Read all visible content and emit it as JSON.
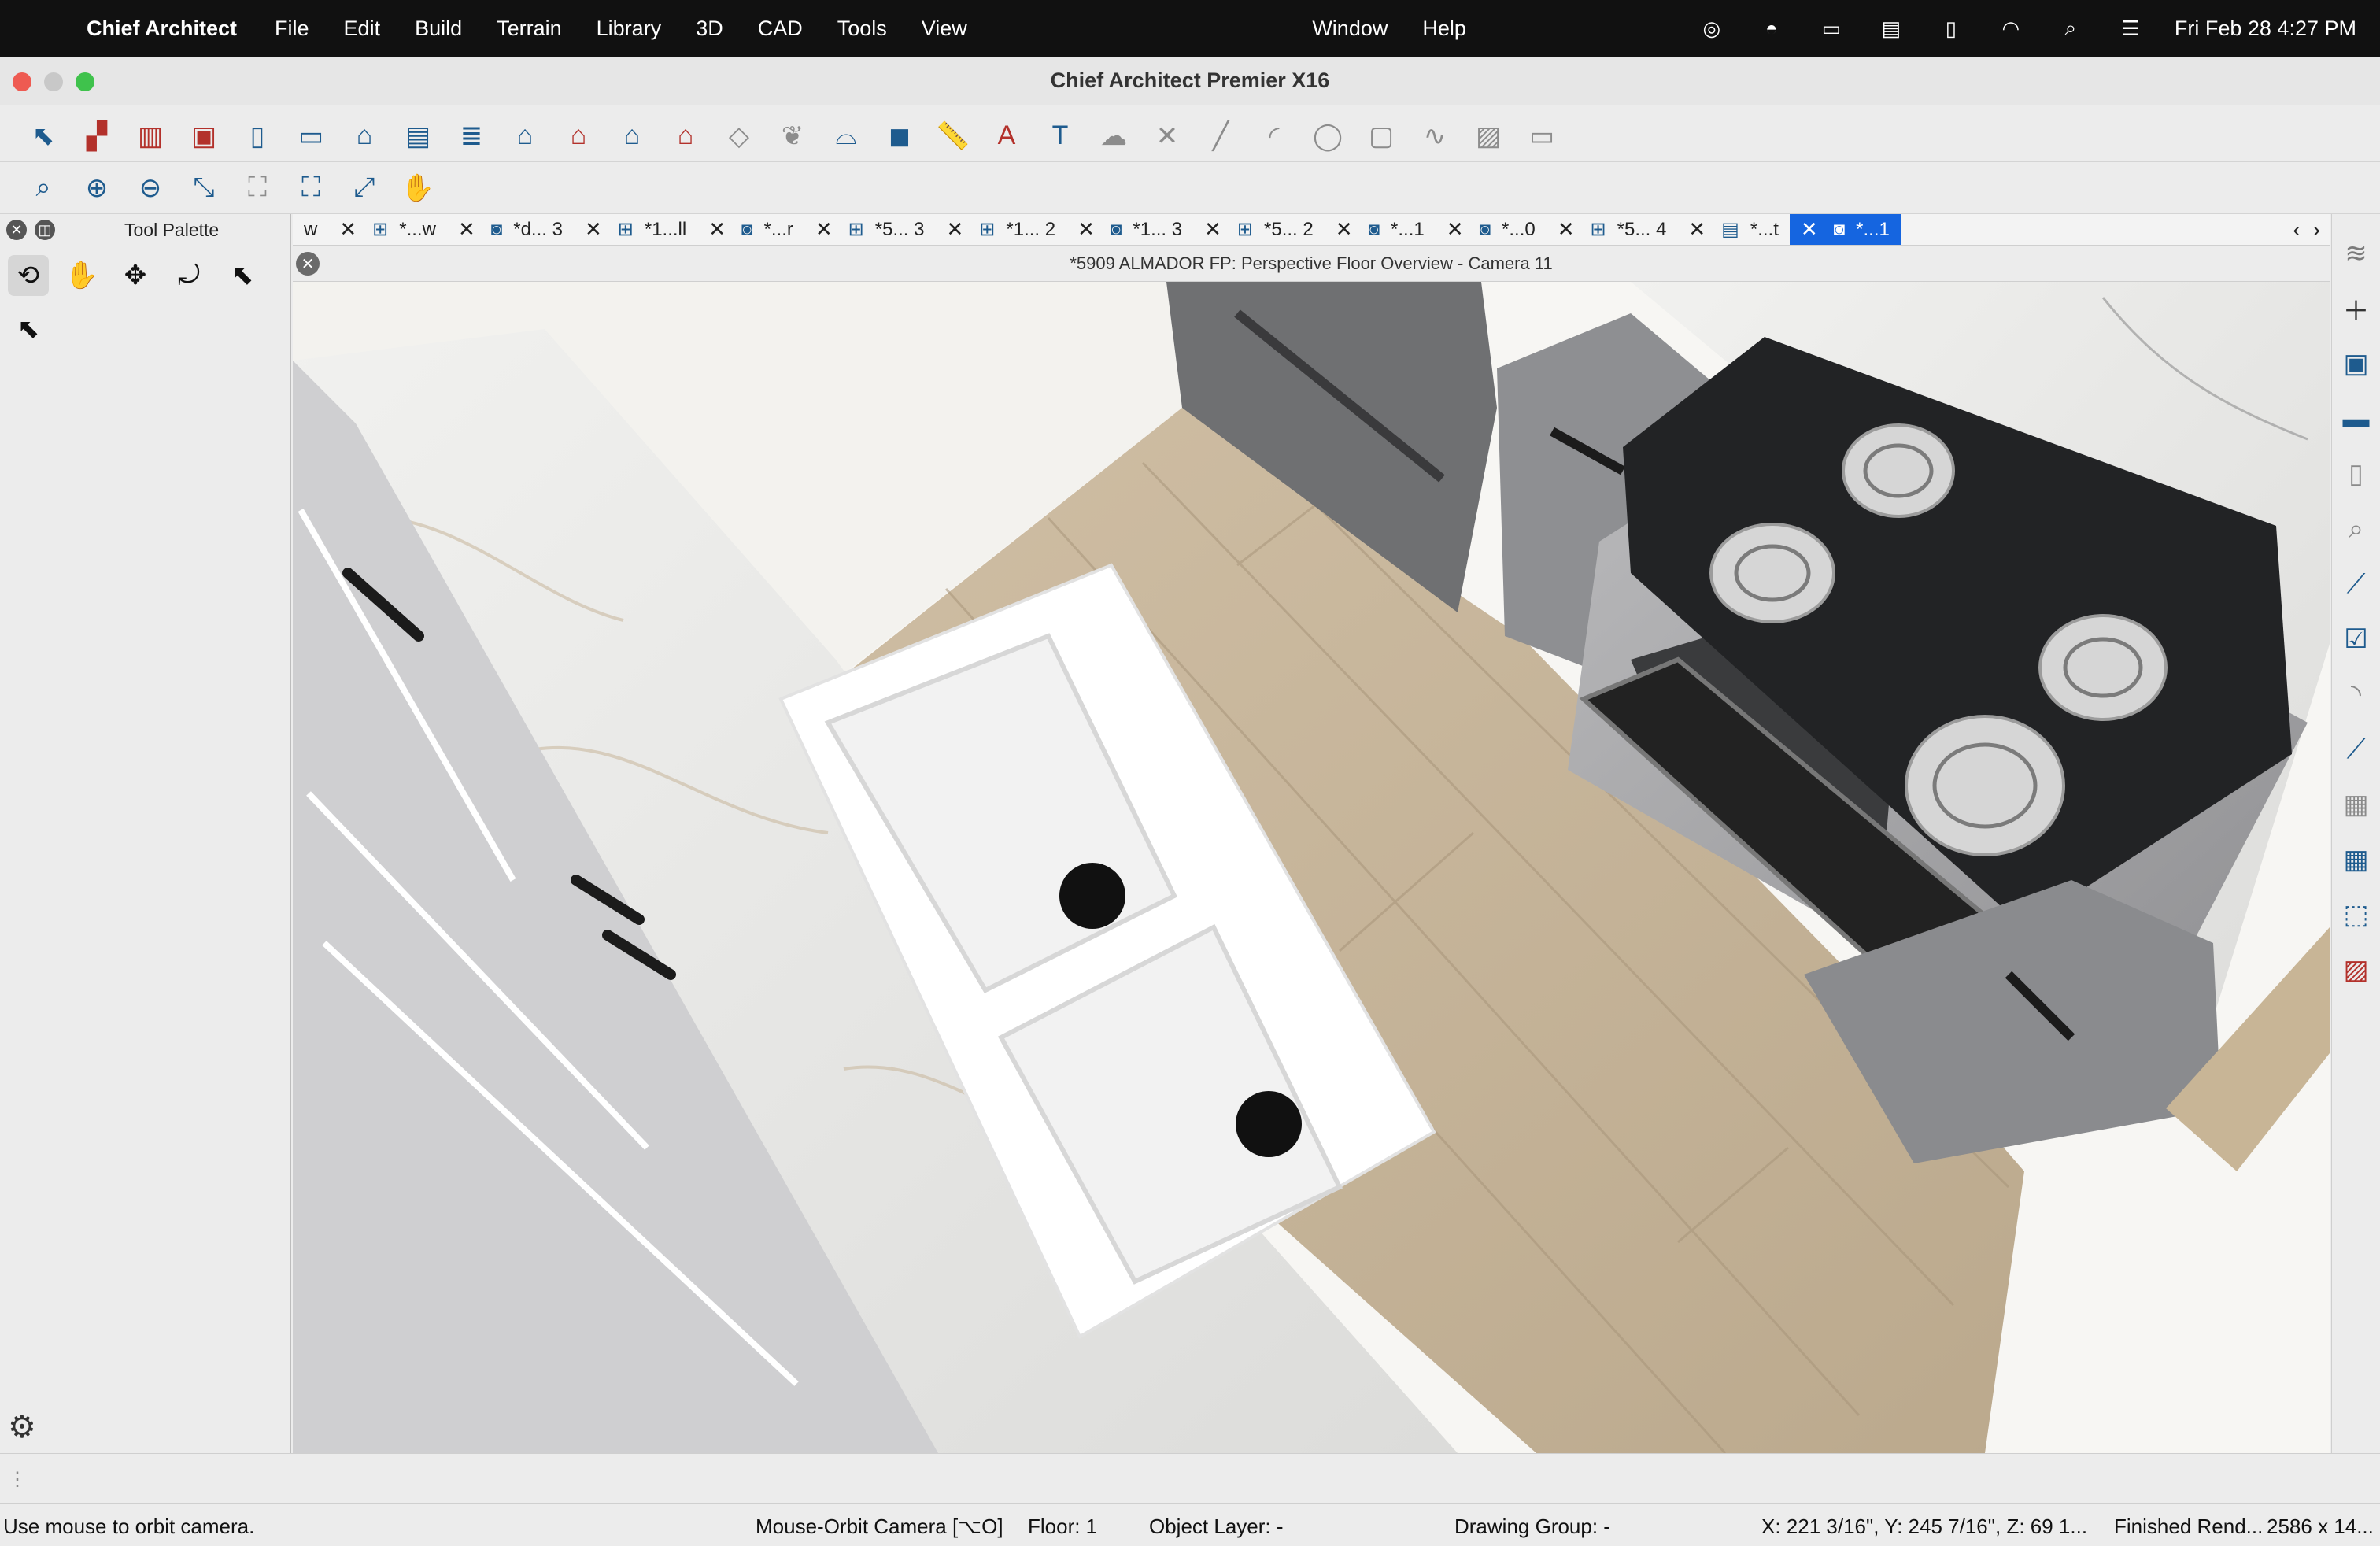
{
  "menubar": {
    "app_name": "Chief Architect",
    "items": [
      "File",
      "Edit",
      "Build",
      "Terrain",
      "Library",
      "3D",
      "CAD",
      "Tools",
      "View"
    ],
    "right_items": [
      "Window",
      "Help"
    ],
    "clock": "Fri Feb 28  4:27 PM"
  },
  "window": {
    "title": "Chief Architect Premier X16"
  },
  "palette": {
    "title": "Tool Palette"
  },
  "tabs": [
    {
      "label": "w"
    },
    {
      "label": "*...w"
    },
    {
      "label": "*d... 3"
    },
    {
      "label": "*1...ll"
    },
    {
      "label": "*...r"
    },
    {
      "label": "*5... 3"
    },
    {
      "label": "*1... 2"
    },
    {
      "label": "*1... 3"
    },
    {
      "label": "*5... 2"
    },
    {
      "label": "*...1"
    },
    {
      "label": "*...0"
    },
    {
      "label": "*5... 4"
    },
    {
      "label": "*...t"
    },
    {
      "label": "*...1"
    }
  ],
  "view": {
    "title": "*5909 ALMADOR FP: Perspective Floor Overview - Camera 11"
  },
  "status": {
    "hint": "Use mouse to orbit camera.",
    "mode": "Mouse-Orbit Camera [⌥O]",
    "floor": "Floor: 1",
    "layer": "Object Layer: -",
    "group": "Drawing Group: -",
    "coords": "X: 221 3/16\", Y: 245 7/16\", Z: 69 1...",
    "render": "Finished Rend...",
    "size": "2586 x 14..."
  }
}
